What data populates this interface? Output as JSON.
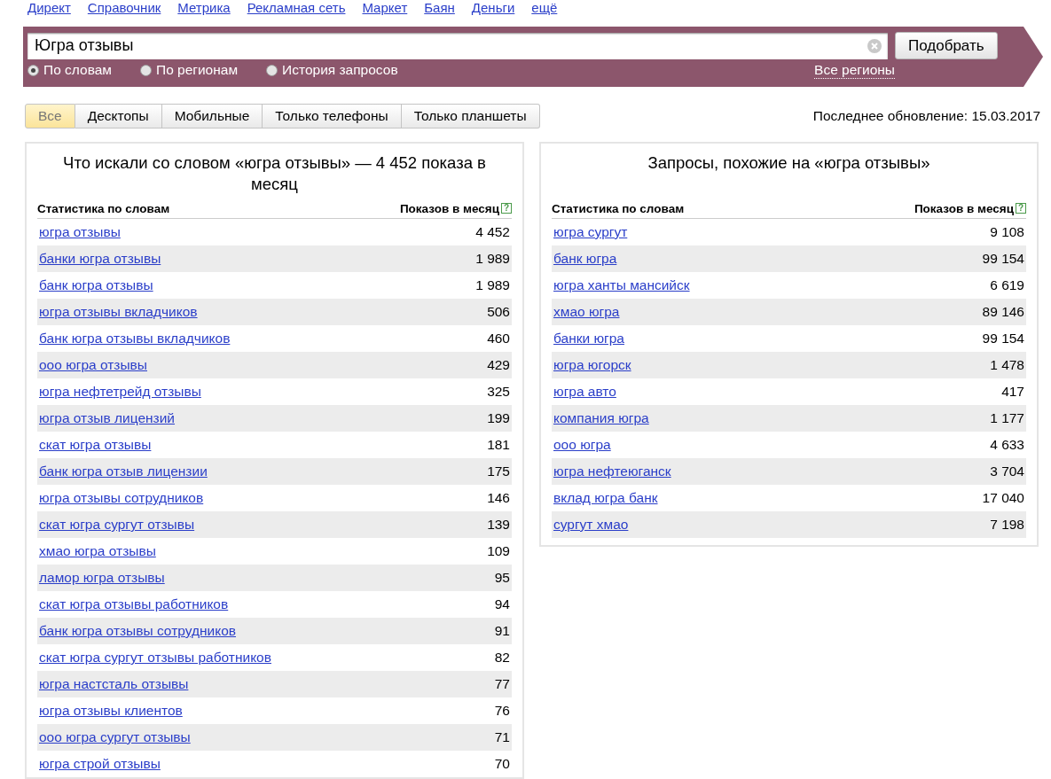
{
  "nav": [
    "Директ",
    "Справочник",
    "Метрика",
    "Рекламная сеть",
    "Маркет",
    "Баян",
    "Деньги",
    "ещё"
  ],
  "search": {
    "value": "Югра отзывы",
    "button": "Подобрать",
    "modes": [
      {
        "label": "По словам",
        "selected": true
      },
      {
        "label": "По регионам",
        "selected": false
      },
      {
        "label": "История запросов",
        "selected": false
      }
    ],
    "regions_link": "Все регионы"
  },
  "tabs": [
    {
      "label": "Все",
      "selected": true
    },
    {
      "label": "Десктопы",
      "selected": false
    },
    {
      "label": "Мобильные",
      "selected": false
    },
    {
      "label": "Только телефоны",
      "selected": false
    },
    {
      "label": "Только планшеты",
      "selected": false
    }
  ],
  "last_update": "Последнее обновление: 15.03.2017",
  "panels": [
    {
      "title": "Что искали со словом «югра отзывы» — 4 452 показа в месяц",
      "columns": [
        "Статистика по словам",
        "Показов в месяц"
      ],
      "help": "?",
      "rows": [
        [
          "югра отзывы",
          "4 452"
        ],
        [
          "банки югра отзывы",
          "1 989"
        ],
        [
          "банк югра отзывы",
          "1 989"
        ],
        [
          "югра отзывы вкладчиков",
          "506"
        ],
        [
          "банк югра отзывы вкладчиков",
          "460"
        ],
        [
          "ооо югра отзывы",
          "429"
        ],
        [
          "югра нефтетрейд отзывы",
          "325"
        ],
        [
          "югра отзыв лицензий",
          "199"
        ],
        [
          "скат югра отзывы",
          "181"
        ],
        [
          "банк югра отзыв лицензии",
          "175"
        ],
        [
          "югра отзывы сотрудников",
          "146"
        ],
        [
          "скат югра сургут отзывы",
          "139"
        ],
        [
          "хмао югра отзывы",
          "109"
        ],
        [
          "ламор югра отзывы",
          "95"
        ],
        [
          "скат югра отзывы работников",
          "94"
        ],
        [
          "банк югра отзывы сотрудников",
          "91"
        ],
        [
          "скат югра сургут отзывы работников",
          "82"
        ],
        [
          "югра настсталь отзывы",
          "77"
        ],
        [
          "югра отзывы клиентов",
          "76"
        ],
        [
          "ооо югра сургут отзывы",
          "71"
        ],
        [
          "югра строй отзывы",
          "70"
        ]
      ]
    },
    {
      "title": "Запросы, похожие на «югра отзывы»",
      "columns": [
        "Статистика по словам",
        "Показов в месяц"
      ],
      "help": "?",
      "rows": [
        [
          "югра сургут",
          "9 108"
        ],
        [
          "банк югра",
          "99 154"
        ],
        [
          "югра ханты мансийск",
          "6 619"
        ],
        [
          "хмао югра",
          "89 146"
        ],
        [
          "банки югра",
          "99 154"
        ],
        [
          "югра югорск",
          "1 478"
        ],
        [
          "югра авто",
          "417"
        ],
        [
          "компания югра",
          "1 177"
        ],
        [
          "ооо югра",
          "4 633"
        ],
        [
          "югра нефтеюганск",
          "3 704"
        ],
        [
          "вклад югра банк",
          "17 040"
        ],
        [
          "сургут хмао",
          "7 198"
        ]
      ]
    }
  ]
}
